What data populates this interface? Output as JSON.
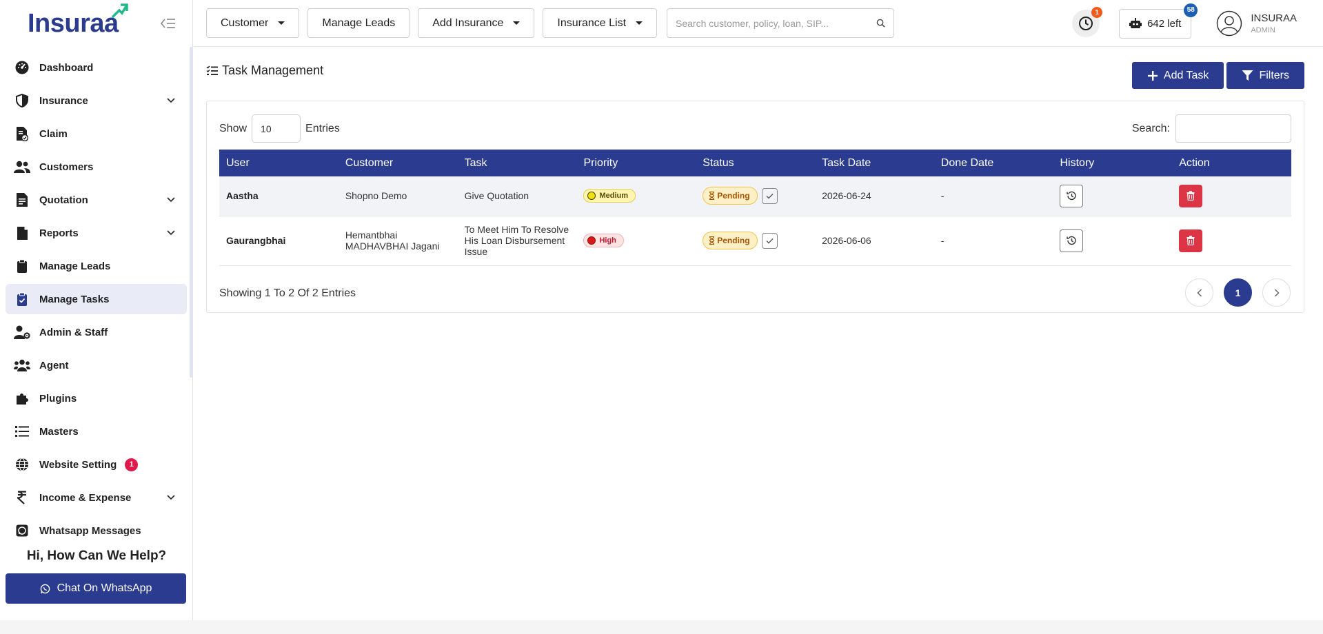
{
  "brand": {
    "name": "Insuraa"
  },
  "sidebar": {
    "items": [
      {
        "label": "Dashboard",
        "icon": "gauge-icon"
      },
      {
        "label": "Insurance",
        "icon": "shield-icon",
        "expandable": true
      },
      {
        "label": "Claim",
        "icon": "claim-document-icon"
      },
      {
        "label": "Customers",
        "icon": "users-icon"
      },
      {
        "label": "Quotation",
        "icon": "quotation-icon",
        "expandable": true
      },
      {
        "label": "Reports",
        "icon": "report-icon",
        "expandable": true
      },
      {
        "label": "Manage Leads",
        "icon": "clipboard-icon"
      },
      {
        "label": "Manage Tasks",
        "icon": "clipboard-check-icon",
        "active": true
      },
      {
        "label": "Admin & Staff",
        "icon": "user-gear-icon"
      },
      {
        "label": "Agent",
        "icon": "group-icon"
      },
      {
        "label": "Plugins",
        "icon": "puzzle-icon"
      },
      {
        "label": "Masters",
        "icon": "list-icon"
      },
      {
        "label": "Website Setting",
        "icon": "globe-icon",
        "badge": "1"
      },
      {
        "label": "Income & Expense",
        "icon": "rupee-icon",
        "expandable": true
      },
      {
        "label": "Whatsapp Messages",
        "icon": "whatsapp-icon"
      }
    ],
    "help_title": "Hi, How Can We Help?",
    "whatsapp_button": "Chat On WhatsApp"
  },
  "header": {
    "customer_menu": "Customer",
    "manage_leads": "Manage Leads",
    "add_insurance": "Add Insurance",
    "insurance_list": "Insurance List",
    "search_placeholder": "Search customer, policy, loan, SIP...",
    "notification_count": "1",
    "credits_label": "642 left",
    "credits_badge": "58",
    "user_name": "INSURAA",
    "user_role": "ADMIN"
  },
  "page": {
    "title": "Task Management",
    "add_task": "Add Task",
    "filters": "Filters",
    "show_label": "Show",
    "entries_label": "Entries",
    "entries_value": "10",
    "search_label": "Search:",
    "columns": [
      "User",
      "Customer",
      "Task",
      "Priority",
      "Status",
      "Task Date",
      "Done Date",
      "History",
      "Action"
    ],
    "rows": [
      {
        "user": "Aastha",
        "customer": "Shopno Demo",
        "task": "Give Quotation",
        "priority": "Medium",
        "status": "Pending",
        "task_date": "2026-06-24",
        "done_date": "-"
      },
      {
        "user": "Gaurangbhai",
        "customer": "Hemantbhai MADHAVBHAI Jagani",
        "task": "To Meet Him To Resolve His Loan Disbursement Issue",
        "priority": "High",
        "status": "Pending",
        "task_date": "2026-06-06",
        "done_date": "-"
      }
    ],
    "showing_text": "Showing 1 To 2 Of 2 Entries",
    "current_page": "1"
  },
  "colors": {
    "primary": "#2b3b8f",
    "danger": "#dc3545",
    "pending_bg": "#fdf0c7",
    "medium_bg": "#fff5b0",
    "high_bg": "#fde3e3"
  }
}
